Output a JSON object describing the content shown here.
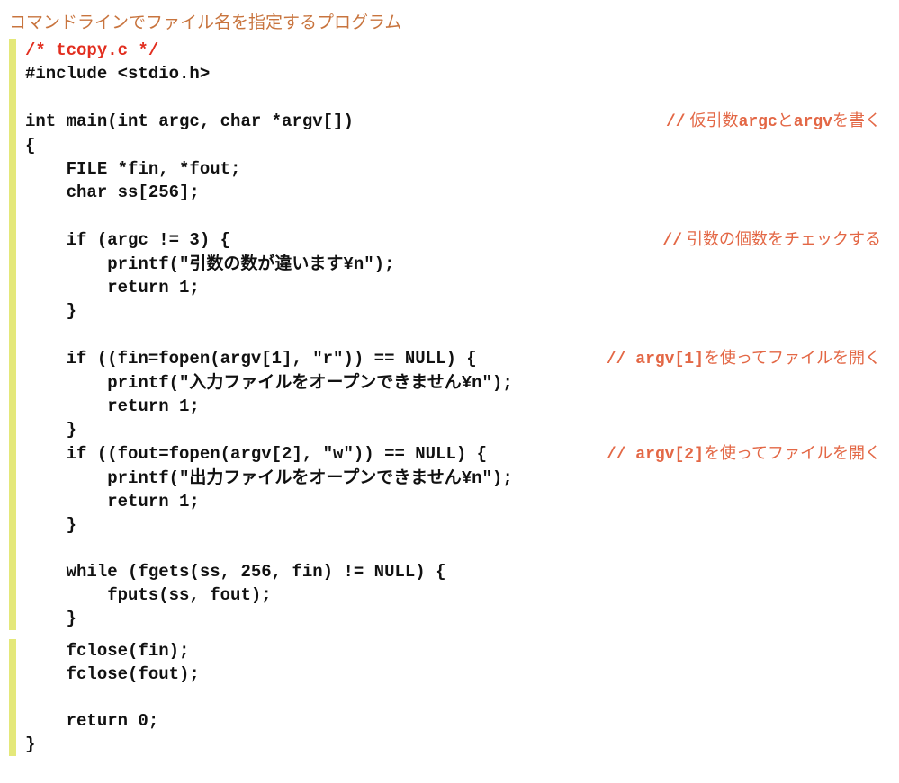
{
  "title": "コマンドラインでファイル名を指定するプログラム",
  "block1": {
    "l1": "/* tcopy.c */",
    "l2": "#include <stdio.h>",
    "l3": "int main(int argc, char *argv[])",
    "c3a": "//",
    "c3b": " 仮引数",
    "c3c": "argc",
    "c3d": "と",
    "c3e": "argv",
    "c3f": "を書く",
    "l4": "{",
    "l5": "    FILE *fin, *fout;",
    "l6": "    char ss[256];",
    "l7": "    if (argc != 3) {",
    "c7a": "//",
    "c7b": " 引数の個数をチェックする",
    "l8": "        printf(\"引数の数が違います¥n\");",
    "l9": "        return 1;",
    "l10": "    }",
    "l11": "    if ((fin=fopen(argv[1], \"r\")) == NULL) {",
    "c11a": "//",
    "c11b": " argv[1]",
    "c11c": "を使ってファイルを開く",
    "l12": "        printf(\"入力ファイルをオープンできません¥n\");",
    "l13": "        return 1;",
    "l14": "    }",
    "l15": "    if ((fout=fopen(argv[2], \"w\")) == NULL) {",
    "c15a": "//",
    "c15b": " argv[2]",
    "c15c": "を使ってファイルを開く",
    "l16": "        printf(\"出力ファイルをオープンできません¥n\");",
    "l17": "        return 1;",
    "l18": "    }",
    "l19": "    while (fgets(ss, 256, fin) != NULL) {",
    "l20": "        fputs(ss, fout);",
    "l21": "    }"
  },
  "block2": {
    "l22": "    fclose(fin);",
    "l23": "    fclose(fout);",
    "l24": "    return 0;",
    "l25": "}"
  }
}
